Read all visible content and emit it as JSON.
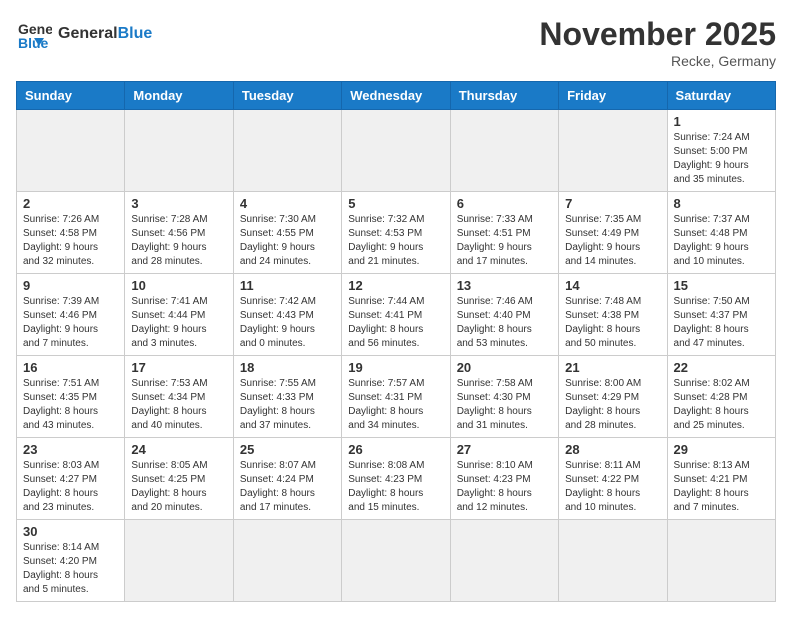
{
  "header": {
    "logo_general": "General",
    "logo_blue": "Blue",
    "month_title": "November 2025",
    "location": "Recke, Germany"
  },
  "weekdays": [
    "Sunday",
    "Monday",
    "Tuesday",
    "Wednesday",
    "Thursday",
    "Friday",
    "Saturday"
  ],
  "weeks": [
    [
      {
        "day": "",
        "info": "",
        "gray": true
      },
      {
        "day": "",
        "info": "",
        "gray": true
      },
      {
        "day": "",
        "info": "",
        "gray": true
      },
      {
        "day": "",
        "info": "",
        "gray": true
      },
      {
        "day": "",
        "info": "",
        "gray": true
      },
      {
        "day": "",
        "info": "",
        "gray": true
      },
      {
        "day": "1",
        "info": "Sunrise: 7:24 AM\nSunset: 5:00 PM\nDaylight: 9 hours\nand 35 minutes.",
        "gray": false
      }
    ],
    [
      {
        "day": "2",
        "info": "Sunrise: 7:26 AM\nSunset: 4:58 PM\nDaylight: 9 hours\nand 32 minutes.",
        "gray": false
      },
      {
        "day": "3",
        "info": "Sunrise: 7:28 AM\nSunset: 4:56 PM\nDaylight: 9 hours\nand 28 minutes.",
        "gray": false
      },
      {
        "day": "4",
        "info": "Sunrise: 7:30 AM\nSunset: 4:55 PM\nDaylight: 9 hours\nand 24 minutes.",
        "gray": false
      },
      {
        "day": "5",
        "info": "Sunrise: 7:32 AM\nSunset: 4:53 PM\nDaylight: 9 hours\nand 21 minutes.",
        "gray": false
      },
      {
        "day": "6",
        "info": "Sunrise: 7:33 AM\nSunset: 4:51 PM\nDaylight: 9 hours\nand 17 minutes.",
        "gray": false
      },
      {
        "day": "7",
        "info": "Sunrise: 7:35 AM\nSunset: 4:49 PM\nDaylight: 9 hours\nand 14 minutes.",
        "gray": false
      },
      {
        "day": "8",
        "info": "Sunrise: 7:37 AM\nSunset: 4:48 PM\nDaylight: 9 hours\nand 10 minutes.",
        "gray": false
      }
    ],
    [
      {
        "day": "9",
        "info": "Sunrise: 7:39 AM\nSunset: 4:46 PM\nDaylight: 9 hours\nand 7 minutes.",
        "gray": false
      },
      {
        "day": "10",
        "info": "Sunrise: 7:41 AM\nSunset: 4:44 PM\nDaylight: 9 hours\nand 3 minutes.",
        "gray": false
      },
      {
        "day": "11",
        "info": "Sunrise: 7:42 AM\nSunset: 4:43 PM\nDaylight: 9 hours\nand 0 minutes.",
        "gray": false
      },
      {
        "day": "12",
        "info": "Sunrise: 7:44 AM\nSunset: 4:41 PM\nDaylight: 8 hours\nand 56 minutes.",
        "gray": false
      },
      {
        "day": "13",
        "info": "Sunrise: 7:46 AM\nSunset: 4:40 PM\nDaylight: 8 hours\nand 53 minutes.",
        "gray": false
      },
      {
        "day": "14",
        "info": "Sunrise: 7:48 AM\nSunset: 4:38 PM\nDaylight: 8 hours\nand 50 minutes.",
        "gray": false
      },
      {
        "day": "15",
        "info": "Sunrise: 7:50 AM\nSunset: 4:37 PM\nDaylight: 8 hours\nand 47 minutes.",
        "gray": false
      }
    ],
    [
      {
        "day": "16",
        "info": "Sunrise: 7:51 AM\nSunset: 4:35 PM\nDaylight: 8 hours\nand 43 minutes.",
        "gray": false
      },
      {
        "day": "17",
        "info": "Sunrise: 7:53 AM\nSunset: 4:34 PM\nDaylight: 8 hours\nand 40 minutes.",
        "gray": false
      },
      {
        "day": "18",
        "info": "Sunrise: 7:55 AM\nSunset: 4:33 PM\nDaylight: 8 hours\nand 37 minutes.",
        "gray": false
      },
      {
        "day": "19",
        "info": "Sunrise: 7:57 AM\nSunset: 4:31 PM\nDaylight: 8 hours\nand 34 minutes.",
        "gray": false
      },
      {
        "day": "20",
        "info": "Sunrise: 7:58 AM\nSunset: 4:30 PM\nDaylight: 8 hours\nand 31 minutes.",
        "gray": false
      },
      {
        "day": "21",
        "info": "Sunrise: 8:00 AM\nSunset: 4:29 PM\nDaylight: 8 hours\nand 28 minutes.",
        "gray": false
      },
      {
        "day": "22",
        "info": "Sunrise: 8:02 AM\nSunset: 4:28 PM\nDaylight: 8 hours\nand 25 minutes.",
        "gray": false
      }
    ],
    [
      {
        "day": "23",
        "info": "Sunrise: 8:03 AM\nSunset: 4:27 PM\nDaylight: 8 hours\nand 23 minutes.",
        "gray": false
      },
      {
        "day": "24",
        "info": "Sunrise: 8:05 AM\nSunset: 4:25 PM\nDaylight: 8 hours\nand 20 minutes.",
        "gray": false
      },
      {
        "day": "25",
        "info": "Sunrise: 8:07 AM\nSunset: 4:24 PM\nDaylight: 8 hours\nand 17 minutes.",
        "gray": false
      },
      {
        "day": "26",
        "info": "Sunrise: 8:08 AM\nSunset: 4:23 PM\nDaylight: 8 hours\nand 15 minutes.",
        "gray": false
      },
      {
        "day": "27",
        "info": "Sunrise: 8:10 AM\nSunset: 4:23 PM\nDaylight: 8 hours\nand 12 minutes.",
        "gray": false
      },
      {
        "day": "28",
        "info": "Sunrise: 8:11 AM\nSunset: 4:22 PM\nDaylight: 8 hours\nand 10 minutes.",
        "gray": false
      },
      {
        "day": "29",
        "info": "Sunrise: 8:13 AM\nSunset: 4:21 PM\nDaylight: 8 hours\nand 7 minutes.",
        "gray": false
      }
    ],
    [
      {
        "day": "30",
        "info": "Sunrise: 8:14 AM\nSunset: 4:20 PM\nDaylight: 8 hours\nand 5 minutes.",
        "gray": false
      },
      {
        "day": "",
        "info": "",
        "gray": true
      },
      {
        "day": "",
        "info": "",
        "gray": true
      },
      {
        "day": "",
        "info": "",
        "gray": true
      },
      {
        "day": "",
        "info": "",
        "gray": true
      },
      {
        "day": "",
        "info": "",
        "gray": true
      },
      {
        "day": "",
        "info": "",
        "gray": true
      }
    ]
  ]
}
